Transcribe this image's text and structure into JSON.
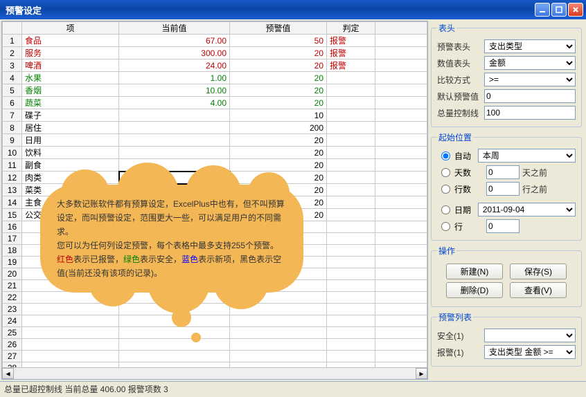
{
  "window": {
    "title": "预警设定"
  },
  "grid": {
    "headers": [
      "项",
      "当前值",
      "预警值",
      "判定"
    ],
    "rows": [
      {
        "n": 1,
        "item": "食品",
        "cur": "67.00",
        "warn": "50",
        "judge": "报警",
        "cls": "txt-red"
      },
      {
        "n": 2,
        "item": "服务",
        "cur": "300.00",
        "warn": "20",
        "judge": "报警",
        "cls": "txt-red"
      },
      {
        "n": 3,
        "item": "啤酒",
        "cur": "24.00",
        "warn": "20",
        "judge": "报警",
        "cls": "txt-red"
      },
      {
        "n": 4,
        "item": "水果",
        "cur": "1.00",
        "warn": "20",
        "judge": "",
        "cls": "txt-green"
      },
      {
        "n": 5,
        "item": "香烟",
        "cur": "10.00",
        "warn": "20",
        "judge": "",
        "cls": "txt-green"
      },
      {
        "n": 6,
        "item": "蔬菜",
        "cur": "4.00",
        "warn": "20",
        "judge": "",
        "cls": "txt-green"
      },
      {
        "n": 7,
        "item": "碟子",
        "cur": "",
        "warn": "10",
        "judge": "",
        "cls": ""
      },
      {
        "n": 8,
        "item": "居住",
        "cur": "",
        "warn": "200",
        "judge": "",
        "cls": ""
      },
      {
        "n": 9,
        "item": "日用",
        "cur": "",
        "warn": "20",
        "judge": "",
        "cls": ""
      },
      {
        "n": 10,
        "item": "饮料",
        "cur": "",
        "warn": "20",
        "judge": "",
        "cls": ""
      },
      {
        "n": 11,
        "item": "副食",
        "cur": "",
        "warn": "20",
        "judge": "",
        "cls": ""
      },
      {
        "n": 12,
        "item": "肉类",
        "cur": "",
        "warn": "20",
        "judge": "",
        "cls": "",
        "sel": true
      },
      {
        "n": 13,
        "item": "菜类",
        "cur": "",
        "warn": "20",
        "judge": "",
        "cls": ""
      },
      {
        "n": 14,
        "item": "主食",
        "cur": "",
        "warn": "20",
        "judge": "",
        "cls": ""
      },
      {
        "n": 15,
        "item": "公交",
        "cur": "",
        "warn": "20",
        "judge": "",
        "cls": ""
      }
    ],
    "empty_rows": 13
  },
  "cloud": {
    "p1": "大多数记账软件都有预算设定，ExcelPlus中也有，但不叫预算设定，而叫预警设定，范围更大一些，可以满足用户的不同需求。",
    "p2": "您可以为任何列设定预警，每个表格中最多支持255个预警。",
    "p3a": "红色",
    "p3b": "表示已报警，",
    "p3c": "绿色",
    "p3d": "表示安全，",
    "p3e": "蓝色",
    "p3f": "表示新项，黑色表示空值(当前还没有该项的记录)。"
  },
  "header_group": {
    "legend": "表头",
    "warn_header_lbl": "预警表头",
    "warn_header_val": "支出类型",
    "value_header_lbl": "数值表头",
    "value_header_val": "金额",
    "compare_lbl": "比较方式",
    "compare_val": ">=",
    "default_warn_lbl": "默认预警值",
    "default_warn_val": "0",
    "total_ctrl_lbl": "总量控制线",
    "total_ctrl_val": "100"
  },
  "start_group": {
    "legend": "起始位置",
    "auto_lbl": "自动",
    "auto_val": "本周",
    "days_lbl": "天数",
    "days_val": "0",
    "days_suffix": "天之前",
    "rows_lbl": "行数",
    "rows_val": "0",
    "rows_suffix": "行之前",
    "date_lbl": "日期",
    "date_val": "2011-09-04",
    "row_lbl": "行",
    "row_val": "0"
  },
  "ops_group": {
    "legend": "操作",
    "new_btn": "新建(N)",
    "save_btn": "保存(S)",
    "del_btn": "删除(D)",
    "view_btn": "查看(V)"
  },
  "list_group": {
    "legend": "预警列表",
    "safe_lbl": "安全(1)",
    "safe_val": "",
    "alarm_lbl": "报警(1)",
    "alarm_val": "支出类型 金额 >="
  },
  "status": "总量已超控制线 当前总量 406.00 报警项数 3"
}
